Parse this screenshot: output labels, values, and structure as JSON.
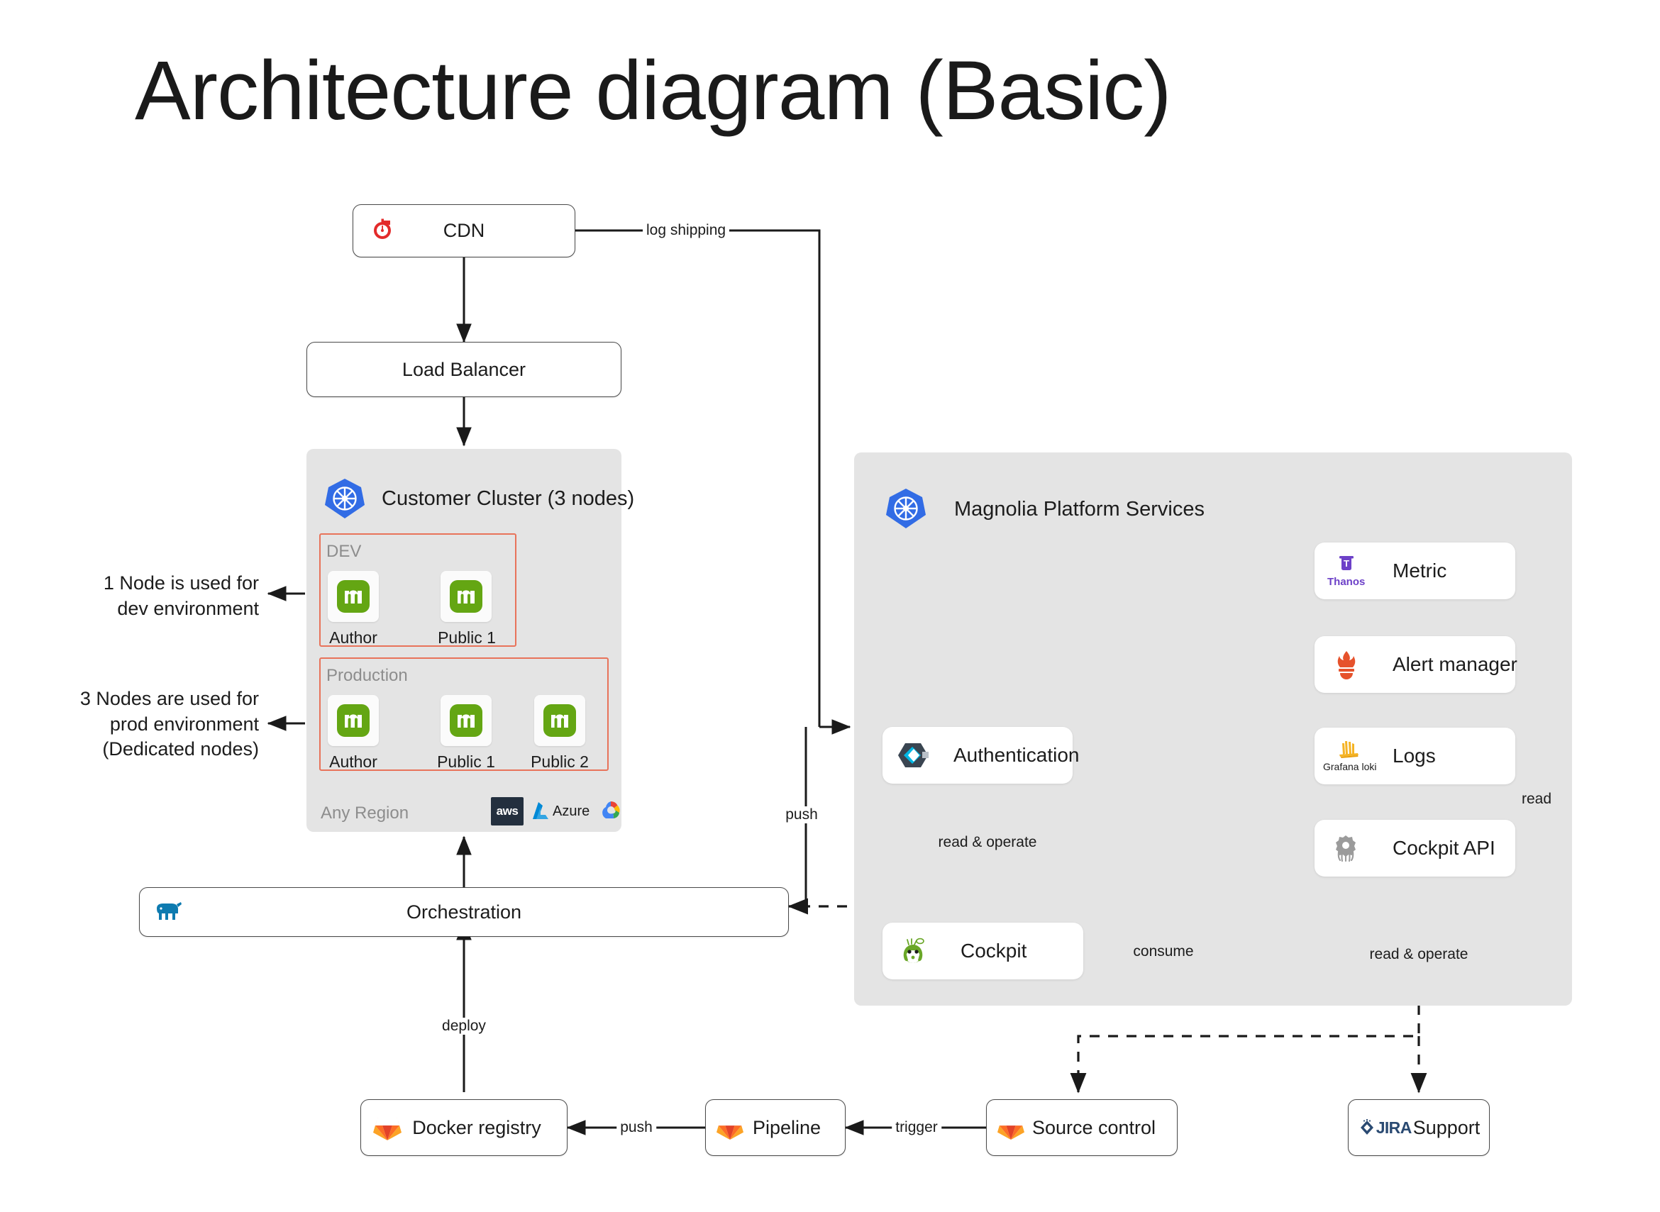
{
  "title": "Architecture diagram (Basic)",
  "nodes": {
    "cdn": {
      "label": "CDN",
      "icon": "fastly-icon"
    },
    "load_balancer": {
      "label": "Load Balancer",
      "icon": "none"
    },
    "orchestration": {
      "label": "Orchestration",
      "icon": "pulumi-elephant-icon"
    },
    "docker_registry": {
      "label": "Docker registry",
      "icon": "gitlab-icon"
    },
    "pipeline": {
      "label": "Pipeline",
      "icon": "gitlab-icon"
    },
    "source_control": {
      "label": "Source control",
      "icon": "gitlab-icon"
    },
    "support": {
      "label": "Support",
      "icon": "jira-icon"
    }
  },
  "customer_cluster": {
    "title": "Customer Cluster (3 nodes)",
    "icon": "kubernetes-icon",
    "any_region": "Any Region",
    "cloud_logos": [
      "aws-icon",
      "azure-icon",
      "google-cloud-icon"
    ],
    "azure_label": "Azure",
    "aws_label": "aws",
    "groups": [
      {
        "name": "DEV",
        "nodes": [
          {
            "label": "Author",
            "icon": "magnolia-icon"
          },
          {
            "label": "Public 1",
            "icon": "magnolia-icon"
          }
        ]
      },
      {
        "name": "Production",
        "nodes": [
          {
            "label": "Author",
            "icon": "magnolia-icon"
          },
          {
            "label": "Public 1",
            "icon": "magnolia-icon"
          },
          {
            "label": "Public 2",
            "icon": "magnolia-icon"
          }
        ]
      }
    ]
  },
  "platform": {
    "title": "Magnolia Platform Services",
    "icon": "kubernetes-icon",
    "services": [
      {
        "label": "Metric",
        "icon": "thanos-icon",
        "icon_text": "Thanos"
      },
      {
        "label": "Alert manager",
        "icon": "prometheus-icon"
      },
      {
        "label": "Logs",
        "icon": "grafana-loki-icon",
        "icon_text": "Grafana loki"
      },
      {
        "label": "Cockpit API",
        "icon": "cockpit-api-icon"
      },
      {
        "label": "Authentication",
        "icon": "authentication-icon"
      },
      {
        "label": "Cockpit",
        "icon": "cockpit-icon"
      }
    ]
  },
  "annotations": {
    "dev_note": "1 Node is used for\ndev environment",
    "prod_note": "3 Nodes are used for\nprod environment\n(Dedicated nodes)"
  },
  "edge_labels": {
    "log_shipping": "log shipping",
    "push_cdn": "push",
    "deploy": "deploy",
    "push_registry": "push",
    "trigger": "trigger",
    "consume": "consume",
    "read": "read",
    "read_operate_auth": "read & operate",
    "read_operate_api": "read & operate"
  },
  "colors": {
    "panel_bg": "#e4e4e4",
    "subgroup_border": "#e8735a",
    "magnolia_green": "#64a613",
    "kubernetes_blue": "#326ce5",
    "fastly_red": "#e32b2b",
    "gitlab_orange": "#e24329",
    "prometheus_orange": "#e6522c",
    "thanos_purple": "#6d41c8",
    "loki_yellow": "#f5b324",
    "jira_blue": "#2684ff",
    "edge_stroke": "#1a1a1a"
  }
}
